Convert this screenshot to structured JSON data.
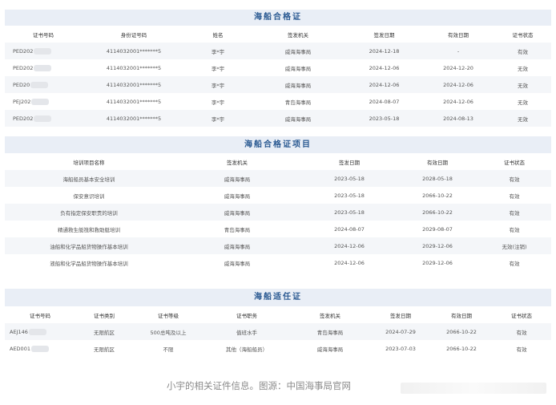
{
  "cert": {
    "title": "海船合格证",
    "headers": [
      "证书号码",
      "身份证号码",
      "姓名",
      "签发机关",
      "签发日期",
      "有效日期",
      "证书状态"
    ],
    "rows": [
      [
        "PED202",
        "4114032001*******5",
        "李*宇",
        "威海海事局",
        "2024-12-18",
        "-",
        "有效"
      ],
      [
        "PED202",
        "4114032001*******5",
        "李*宇",
        "威海海事局",
        "2024-12-06",
        "2024-12-20",
        "无效"
      ],
      [
        "PED20",
        "4114032001*******5",
        "李*宇",
        "威海海事局",
        "2024-12-06",
        "2024-12-06",
        "无效"
      ],
      [
        "PEJ202",
        "4114032001*******5",
        "李*宇",
        "青岛海事局",
        "2024-08-07",
        "2024-12-06",
        "无效"
      ],
      [
        "PED202",
        "4114032001*******5",
        "李*宇",
        "威海海事局",
        "2023-05-18",
        "2024-08-13",
        "无效"
      ]
    ]
  },
  "projects": {
    "title": "海船合格证项目",
    "headers": [
      "培训项目名称",
      "签发机关",
      "签发日期",
      "有效日期",
      "证书状态"
    ],
    "rows": [
      [
        "海船船员基本安全培训",
        "威海海事局",
        "2023-05-18",
        "2028-05-18",
        "有效"
      ],
      [
        "保安意识培训",
        "威海海事局",
        "2023-05-18",
        "2066-10-22",
        "有效"
      ],
      [
        "负有指定保安职责的培训",
        "威海海事局",
        "2023-05-18",
        "2066-10-22",
        "有效"
      ],
      [
        "精通救生艇筏和救助艇培训",
        "青岛海事局",
        "2024-08-07",
        "2029-08-07",
        "有效"
      ],
      [
        "油船和化学品船货物操作基本培训",
        "威海海事局",
        "2024-12-06",
        "2029-12-06",
        "无效(注销)"
      ],
      [
        "液船和化学品船货物操作基本培训",
        "威海海事局",
        "2024-12-06",
        "2029-12-06",
        "有效"
      ]
    ]
  },
  "competency": {
    "title": "海船适任证",
    "headers": [
      "证书号码",
      "证书类别",
      "证书等级",
      "证书职务",
      "签发机关",
      "签发日期",
      "有效日期",
      "证书状态"
    ],
    "rows": [
      [
        "AEJ146",
        "无限航区",
        "500总吨及以上",
        "值班水手",
        "青岛海事局",
        "2024-07-29",
        "2066-10-22",
        "有效"
      ],
      [
        "AED001",
        "无限航区",
        "不限",
        "其他（海船船员）",
        "威海海事局",
        "2023-07-03",
        "2066-10-22",
        "有效"
      ]
    ]
  },
  "footer": {
    "watermark": "小宇的相关证件信息。图源：中国海事局官网"
  }
}
